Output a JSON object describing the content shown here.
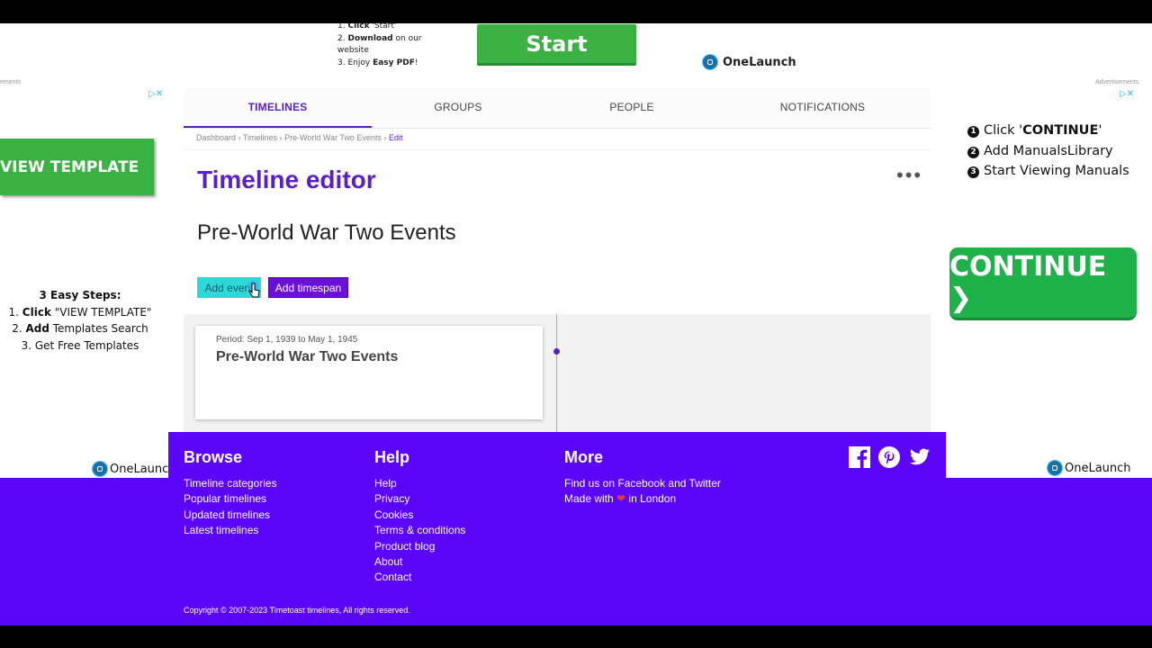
{
  "top_ad": {
    "steps": [
      {
        "num": "1.",
        "bold": "Click",
        "text": " 'Start'"
      },
      {
        "num": "2.",
        "bold": "Download",
        "text": " on our"
      },
      {
        "num": "",
        "bold": "",
        "text": "website"
      },
      {
        "num": "3.",
        "bold": "",
        "text": "Enjoy ",
        "bold2": "Easy PDF",
        "tail": "!"
      }
    ],
    "start_label": "Start",
    "onelaunch": "OneLaunch"
  },
  "ads_label": "Advertisements",
  "adchoice": "▷✕",
  "left_ad": {
    "button_label": "VIEW TEMPLATE",
    "steps_title": "3 Easy Steps:",
    "step1_bold": "Click",
    "step1_text": " \"VIEW TEMPLATE\"",
    "step2_bold": "Add",
    "step2_text": " Templates Search",
    "step3": "Get Free Templates",
    "onelaunch": "OneLaunch"
  },
  "right_ad": {
    "step1_a": "Click '",
    "step1_b": "CONTINUE",
    "step1_c": "'",
    "step2": "Add ManualsLibrary",
    "step3": "Start Viewing Manuals",
    "button_label": "CONTINUE ❯",
    "onelaunch": "OneLaunch"
  },
  "nav": {
    "tabs": [
      {
        "label": "TIMELINES",
        "active": true
      },
      {
        "label": "GROUPS"
      },
      {
        "label": "PEOPLE"
      },
      {
        "label": "NOTIFICATIONS"
      }
    ]
  },
  "breadcrumb": {
    "items": [
      "Dashboard",
      "Timelines",
      "Pre-World War Two Events"
    ],
    "sep": " › ",
    "current": "Edit"
  },
  "editor": {
    "title": "Timeline editor",
    "menu": "•••",
    "timeline_name": "Pre-World War Two Events",
    "add_event": "Add event",
    "add_timespan": "Add timespan"
  },
  "card": {
    "period": "Period: Sep 1, 1939 to May 1, 1945",
    "title": "Pre-World War Two Events"
  },
  "footer": {
    "browse": {
      "heading": "Browse",
      "links": [
        "Timeline categories",
        "Popular timelines",
        "Updated timelines",
        "Latest timelines"
      ]
    },
    "help": {
      "heading": "Help",
      "links": [
        "Help",
        "Privacy",
        "Cookies",
        "Terms & conditions",
        "Product blog",
        "About",
        "Contact"
      ]
    },
    "more": {
      "heading": "More",
      "find_us": "Find us on Facebook and Twitter",
      "made_with_a": "Made with ",
      "made_with_b": " in London"
    },
    "copyright": "Copyright © 2007-2023 Timetoast timelines, All rights reserved.",
    "social": [
      "facebook-icon",
      "pinterest-icon",
      "twitter-icon"
    ]
  }
}
